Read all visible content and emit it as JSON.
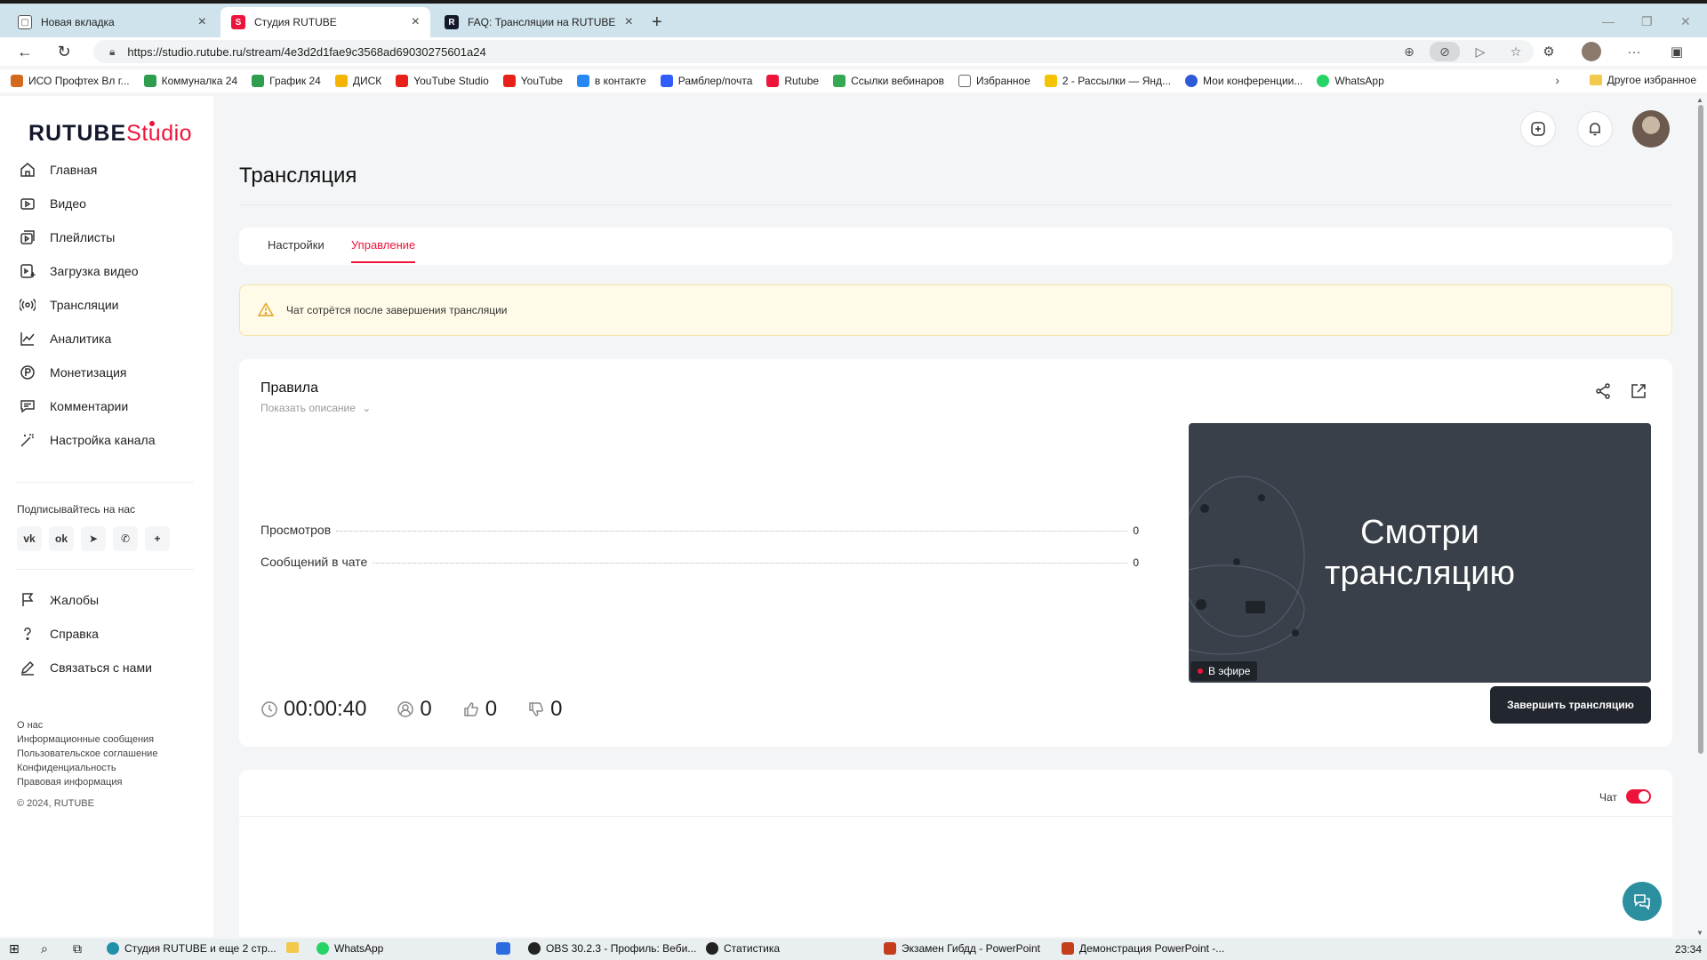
{
  "browser": {
    "tabs": [
      {
        "label": "Новая вкладка",
        "active": false
      },
      {
        "label": "Студия RUTUBE",
        "active": true
      },
      {
        "label": "FAQ: Трансляции на RUTUBE",
        "active": false
      }
    ],
    "url": "https://studio.rutube.ru/stream/4e3d2d1fae9c3568ad69030275601a24",
    "bookmarks": [
      "ИСО Профтех Вл г...",
      "Коммуналка 24",
      "График 24",
      "ДИСК",
      "YouTube Studio",
      "YouTube",
      "в контакте",
      "Рамблер/почта",
      "Rutube",
      "Ссылки вебинаров",
      "Избранное",
      "2 - Рассылки — Янд...",
      "Мои конференции...",
      "WhatsApp"
    ],
    "other_bookmarks": "Другое избранное"
  },
  "app": {
    "logo_main": "RUTUBE",
    "logo_studio": "Studio",
    "nav": [
      {
        "label": "Главная",
        "icon": "home-icon"
      },
      {
        "label": "Видео",
        "icon": "video-icon"
      },
      {
        "label": "Плейлисты",
        "icon": "playlist-icon"
      },
      {
        "label": "Загрузка видео",
        "icon": "upload-icon"
      },
      {
        "label": "Трансляции",
        "icon": "broadcast-icon"
      },
      {
        "label": "Аналитика",
        "icon": "analytics-icon"
      },
      {
        "label": "Монетизация",
        "icon": "ruble-icon"
      },
      {
        "label": "Комментарии",
        "icon": "comments-icon"
      },
      {
        "label": "Настройка канала",
        "icon": "magic-wand-icon"
      }
    ],
    "subscribe_title": "Подписывайтесь на нас",
    "socials": [
      "vk-icon",
      "ok-icon",
      "telegram-icon",
      "viber-icon",
      "plus-icon"
    ],
    "nav2": [
      {
        "label": "Жалобы",
        "icon": "flag-icon"
      },
      {
        "label": "Справка",
        "icon": "help-icon"
      },
      {
        "label": "Связаться с нами",
        "icon": "pen-icon"
      }
    ],
    "footer_links": [
      "О нас",
      "Информационные сообщения",
      "Пользовательское соглашение",
      "Конфиденциальность",
      "Правовая информация"
    ],
    "copyright": "© 2024, RUTUBE"
  },
  "page": {
    "title": "Трансляция",
    "tabs": [
      {
        "label": "Настройки",
        "active": false
      },
      {
        "label": "Управление",
        "active": true
      }
    ],
    "warning": "Чат сотрётся после завершения трансляции",
    "stream_name": "Правила",
    "show_description": "Показать описание",
    "stats": [
      {
        "label": "Просмотров",
        "value": "0"
      },
      {
        "label": "Сообщений в чате",
        "value": "0"
      }
    ],
    "preview_text_1": "Смотри",
    "preview_text_2": "трансляцию",
    "live_badge": "В эфире",
    "duration": "00:00:40",
    "viewers": "0",
    "likes": "0",
    "dislikes": "0",
    "end_button": "Завершить трансляцию",
    "chat_label": "Чат",
    "chat_enabled": true
  },
  "taskbar": {
    "items": [
      "Студия RUTUBE и еще 2 стр...",
      "WhatsApp",
      "OBS 30.2.3 - Профиль: Веби...",
      "Статистика",
      "Экзамен Гибдд - PowerPoint",
      "Демонстрация PowerPoint -..."
    ],
    "clock": "23:34"
  },
  "colors": {
    "accent": "#ed143b",
    "dark_button": "#22262e",
    "preview_bg": "#3a4049",
    "support_fab": "#2b8fa0"
  }
}
